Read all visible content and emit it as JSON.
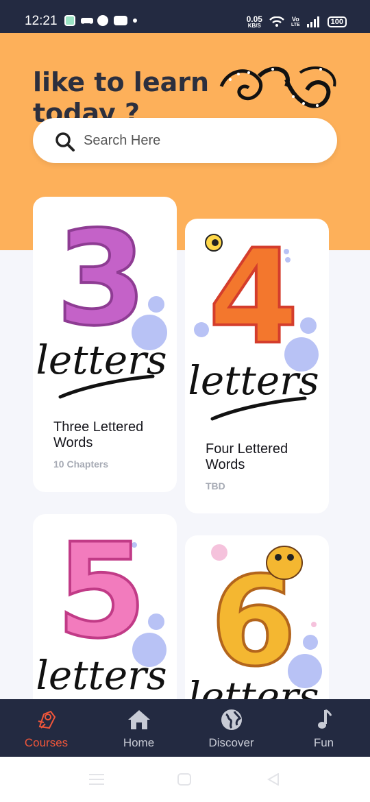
{
  "status_bar": {
    "time": "12:21",
    "net_speed_value": "0.05",
    "net_speed_unit": "KB/S",
    "volte": "Vo",
    "lte": "LTE",
    "battery": "100"
  },
  "hero": {
    "title_line1": "like to learn",
    "title_line2": "today ?"
  },
  "search": {
    "placeholder": "Search Here"
  },
  "courses": [
    {
      "image_number": "3",
      "image_word": "letters",
      "title": "Three Lettered Words",
      "subtitle": "10 Chapters"
    },
    {
      "image_number": "4",
      "image_word": "letters",
      "title": "Four Lettered Words",
      "subtitle": "TBD"
    },
    {
      "image_number": "5",
      "image_word": "letters",
      "title": "",
      "subtitle": ""
    },
    {
      "image_number": "6",
      "image_word": "letters",
      "title": "",
      "subtitle": ""
    }
  ],
  "bottom_nav": {
    "items": [
      {
        "label": "Courses",
        "icon": "courses-icon",
        "active": true
      },
      {
        "label": "Home",
        "icon": "home-icon",
        "active": false
      },
      {
        "label": "Discover",
        "icon": "globe-icon",
        "active": false
      },
      {
        "label": "Fun",
        "icon": "music-note-icon",
        "active": false
      }
    ]
  },
  "colors": {
    "hero_bg": "#fdb05a",
    "nav_bg": "#232a41",
    "active": "#f0563a",
    "page_bg": "#f5f6fb"
  }
}
